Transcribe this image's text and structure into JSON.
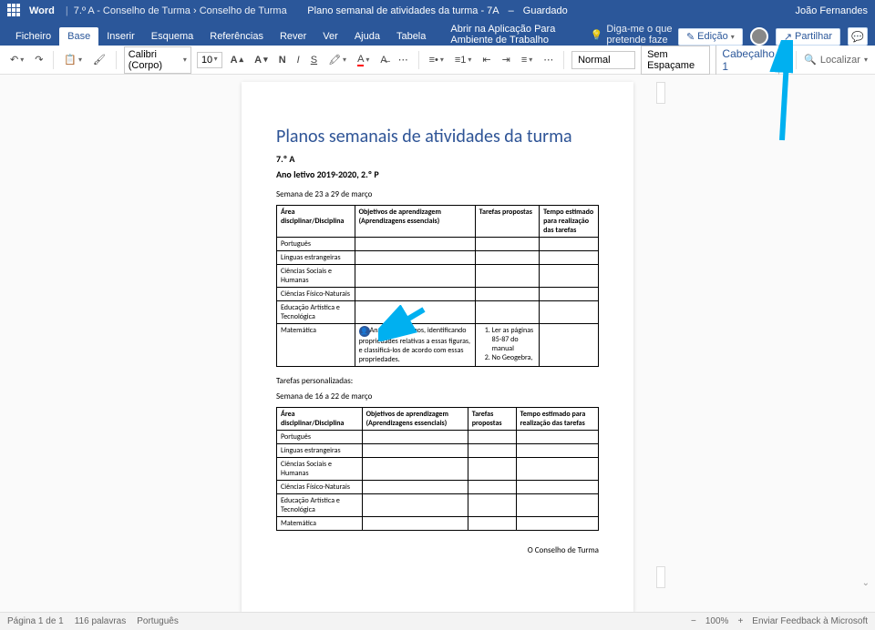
{
  "header": {
    "app": "Word",
    "breadcrumb1": "7.º A - Conselho de Turma",
    "breadcrumb2": "Conselho de Turma",
    "doc_title": "Plano semanal de atividades da turma - 7A",
    "saved": "Guardado",
    "user": "João Fernandes"
  },
  "menu": {
    "ficheiro": "Ficheiro",
    "base": "Base",
    "inserir": "Inserir",
    "esquema": "Esquema",
    "referencias": "Referências",
    "rever": "Rever",
    "ver": "Ver",
    "ajuda": "Ajuda",
    "tabela": "Tabela",
    "open_desktop": "Abrir na Aplicação Para Ambiente de Trabalho",
    "tell_me": "Diga-me o que pretende faze",
    "edicao": "Edição",
    "partilhar": "Partilhar"
  },
  "toolbar": {
    "font_name": "Calibri (Corpo)",
    "font_size": "10",
    "style_normal": "Normal",
    "style_noSpacing": "Sem Espaçame",
    "style_heading1": "Cabeçalho 1",
    "find": "Localizar"
  },
  "doc": {
    "title": "Planos semanais de atividades da turma",
    "class": "7.º A",
    "year": "Ano letivo 2019-2020, 2.º P",
    "week1": "Semana de 23 a 29 de março",
    "week2": "Semana de 16 a 22 de março",
    "perso": "Tarefas personalizadas:",
    "signature": "O Conselho de Turma",
    "headers": {
      "c1": "Área disciplinar/Disciplina",
      "c2": "Objetivos de aprendizagem (Aprendizagens essenciais)",
      "c3": "Tarefas propostas",
      "c4": "Tempo estimado para realização das tarefas"
    },
    "rows": {
      "r1": "Português",
      "r2": "Línguas estrangeiras",
      "r3": "Ciências Sociais e Humanas",
      "r4": "Ciências Físico-Naturais",
      "r5": "Educação Artística e Tecnológica",
      "r6": "Matemática"
    },
    "math": {
      "obj": "Analisar polígonos, identificando propriedades relativas a essas figuras, e classificá-los de acordo com essas propriedades.",
      "task1": "Ler as páginas 85-87 do manual",
      "task2": "No Geogebra,"
    }
  },
  "status": {
    "page": "Página 1 de 1",
    "words": "116 palavras",
    "lang": "Português",
    "zoom": "100%",
    "feedback": "Enviar Feedback à Microsoft"
  }
}
